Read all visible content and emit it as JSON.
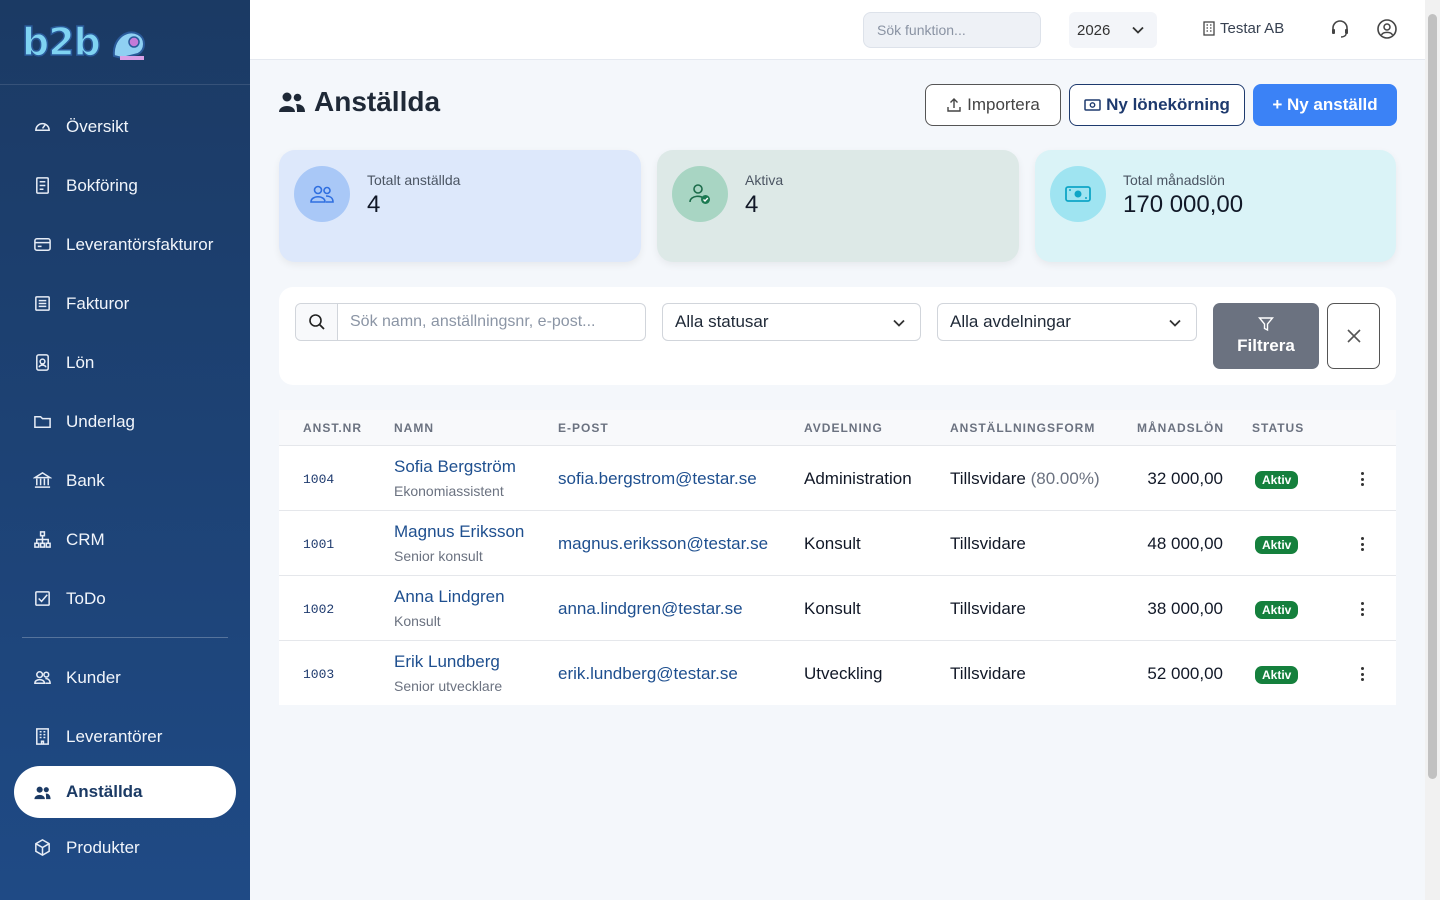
{
  "app": {
    "logo_text": "b2b"
  },
  "sidebar": {
    "items": [
      {
        "label": "Översikt",
        "icon": "speedometer-icon"
      },
      {
        "label": "Bokföring",
        "icon": "journal-icon"
      },
      {
        "label": "Leverantörsfakturor",
        "icon": "credit-card-icon"
      },
      {
        "label": "Fakturor",
        "icon": "receipt-icon"
      },
      {
        "label": "Lön",
        "icon": "badge-icon"
      },
      {
        "label": "Underlag",
        "icon": "folder-icon"
      },
      {
        "label": "Bank",
        "icon": "bank-icon"
      },
      {
        "label": "CRM",
        "icon": "diagram-icon"
      },
      {
        "label": "ToDo",
        "icon": "check-square-icon"
      }
    ],
    "items2": [
      {
        "label": "Kunder",
        "icon": "people-icon"
      },
      {
        "label": "Leverantörer",
        "icon": "building-icon"
      },
      {
        "label": "Anställda",
        "icon": "people-fill-icon",
        "active": true
      },
      {
        "label": "Produkter",
        "icon": "box-icon"
      }
    ]
  },
  "topbar": {
    "search_placeholder": "Sök funktion...",
    "year": "2026",
    "company": "Testar AB"
  },
  "page": {
    "title": "Anställda",
    "import_label": "Importera",
    "payroll_label": "Ny lönekörning",
    "new_label": "+ Ny anställd"
  },
  "stats": [
    {
      "label": "Totalt anställda",
      "value": "4"
    },
    {
      "label": "Aktiva",
      "value": "4"
    },
    {
      "label": "Total månadslön",
      "value": "170 000,00"
    }
  ],
  "filters": {
    "search_placeholder": "Sök namn, anställningsnr, e-post...",
    "status_selected": "Alla statusar",
    "department_selected": "Alla avdelningar",
    "filter_label": "Filtrera"
  },
  "table": {
    "headers": [
      "ANST.NR",
      "NAMN",
      "E-POST",
      "AVDELNING",
      "ANSTÄLLNINGSFORM",
      "MÅNADSLÖN",
      "STATUS"
    ],
    "rows": [
      {
        "nr": "1004",
        "name": "Sofia Bergström",
        "title": "Ekonomiassistent",
        "email": "sofia.bergstrom@testar.se",
        "department": "Administration",
        "form": "Tillsvidare",
        "form_extra": "(80.00%)",
        "salary": "32 000,00",
        "status": "Aktiv"
      },
      {
        "nr": "1001",
        "name": "Magnus Eriksson",
        "title": "Senior konsult",
        "email": "magnus.eriksson@testar.se",
        "department": "Konsult",
        "form": "Tillsvidare",
        "form_extra": "",
        "salary": "48 000,00",
        "status": "Aktiv"
      },
      {
        "nr": "1002",
        "name": "Anna Lindgren",
        "title": "Konsult",
        "email": "anna.lindgren@testar.se",
        "department": "Konsult",
        "form": "Tillsvidare",
        "form_extra": "",
        "salary": "38 000,00",
        "status": "Aktiv"
      },
      {
        "nr": "1003",
        "name": "Erik Lundberg",
        "title": "Senior utvecklare",
        "email": "erik.lundberg@testar.se",
        "department": "Utveckling",
        "form": "Tillsvidare",
        "form_extra": "",
        "salary": "52 000,00",
        "status": "Aktiv"
      }
    ]
  },
  "colors": {
    "sidebar": "#1b3a64",
    "primary": "#3b82f6",
    "success": "#15803d"
  }
}
